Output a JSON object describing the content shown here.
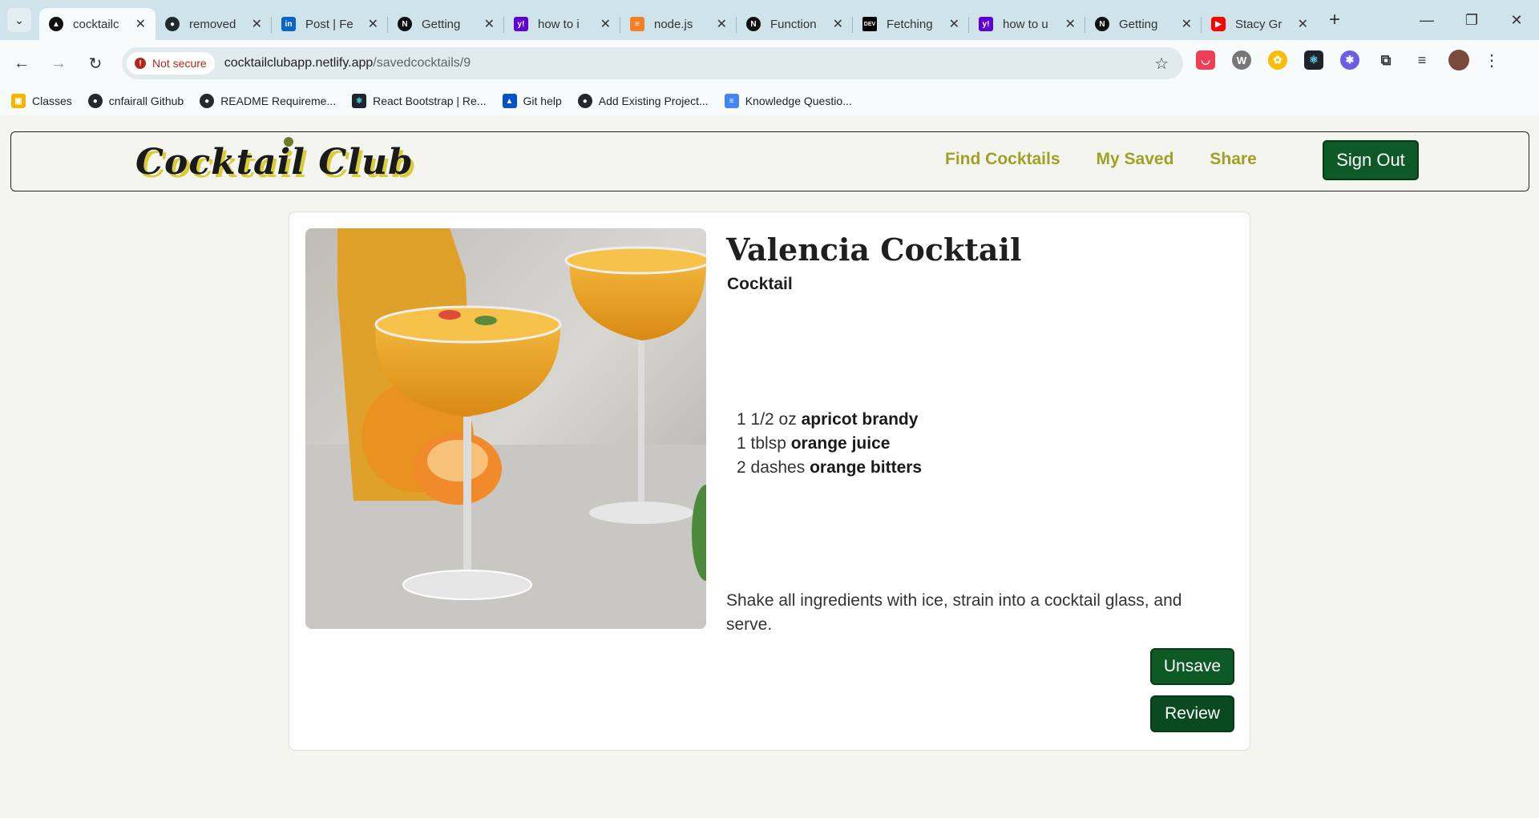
{
  "browser": {
    "tabs": [
      {
        "title": "cocktailc",
        "favicon": "netlify-icon",
        "color": "#111111",
        "active": true
      },
      {
        "title": "removed",
        "favicon": "github-icon",
        "color": "#24292e"
      },
      {
        "title": "Post | Fe",
        "favicon": "linkedin-icon",
        "color": "#0a66c2"
      },
      {
        "title": "Getting",
        "favicon": "nextjs-icon",
        "color": "#111111"
      },
      {
        "title": "how to i",
        "favicon": "yahoo-icon",
        "color": "#6001d2"
      },
      {
        "title": "node.js",
        "favicon": "stackoverflow-icon",
        "color": "#f48024"
      },
      {
        "title": "Function",
        "favicon": "nextjs-icon",
        "color": "#111111"
      },
      {
        "title": "Fetching",
        "favicon": "dev-icon",
        "color": "#000000"
      },
      {
        "title": "how to u",
        "favicon": "yahoo-icon",
        "color": "#6001d2"
      },
      {
        "title": "Getting",
        "favicon": "nextjs-icon",
        "color": "#111111"
      },
      {
        "title": "Stacy Gr",
        "favicon": "youtube-icon",
        "color": "#ff0000"
      }
    ],
    "security_label": "Not secure",
    "url_host": "cocktailclubapp.netlify.app",
    "url_path": "/savedcocktails/9",
    "bookmarks": [
      {
        "label": "Classes",
        "icon": "google-classroom-icon",
        "color": "#f4b400"
      },
      {
        "label": "cnfairall Github",
        "icon": "github-icon",
        "color": "#24292e"
      },
      {
        "label": "README Requireme...",
        "icon": "github-icon",
        "color": "#24292e"
      },
      {
        "label": "React Bootstrap | Re...",
        "icon": "react-bootstrap-icon",
        "color": "#41e0fd"
      },
      {
        "label": "Git help",
        "icon": "atlassian-icon",
        "color": "#0052cc"
      },
      {
        "label": "Add Existing Project...",
        "icon": "github-icon",
        "color": "#24292e"
      },
      {
        "label": "Knowledge Questio...",
        "icon": "google-docs-icon",
        "color": "#4285f4"
      }
    ]
  },
  "site": {
    "logo": "Cocktail Club",
    "nav": [
      "Find Cocktails",
      "My Saved",
      "Share"
    ],
    "sign_out": "Sign Out",
    "accent": "#a0a028",
    "button_color": "#0e5a27"
  },
  "cocktail": {
    "name": "Valencia Cocktail",
    "category": "Cocktail",
    "ingredients": [
      {
        "measure": "1 1/2 oz",
        "item": "apricot brandy"
      },
      {
        "measure": "1 tblsp",
        "item": "orange juice"
      },
      {
        "measure": "2 dashes",
        "item": "orange bitters"
      }
    ],
    "instructions": "Shake all ingredients with ice, strain into a cocktail glass, and serve.",
    "unsave_label": "Unsave",
    "review_label": "Review"
  }
}
